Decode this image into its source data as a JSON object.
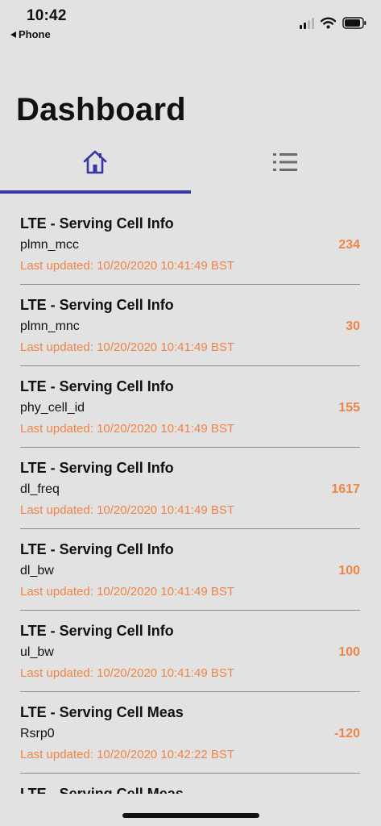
{
  "status_bar": {
    "time": "10:42",
    "back_label": "Phone"
  },
  "page": {
    "title": "Dashboard"
  },
  "tabs": [
    {
      "name": "home",
      "icon": "home-icon",
      "selected": true
    },
    {
      "name": "list",
      "icon": "list-icon",
      "selected": false
    }
  ],
  "colors": {
    "accent": "#3a35a8",
    "value": "#ef8447",
    "background": "#e2e2e2"
  },
  "items": [
    {
      "title": "LTE - Serving Cell Info",
      "key": "plmn_mcc",
      "value": "234",
      "updated": "Last updated: 10/20/2020 10:41:49 BST"
    },
    {
      "title": "LTE - Serving Cell Info",
      "key": "plmn_mnc",
      "value": "30",
      "updated": "Last updated: 10/20/2020 10:41:49 BST"
    },
    {
      "title": "LTE - Serving Cell Info",
      "key": "phy_cell_id",
      "value": "155",
      "updated": "Last updated: 10/20/2020 10:41:49 BST"
    },
    {
      "title": "LTE - Serving Cell Info",
      "key": "dl_freq",
      "value": "1617",
      "updated": "Last updated: 10/20/2020 10:41:49 BST"
    },
    {
      "title": "LTE - Serving Cell Info",
      "key": "dl_bw",
      "value": "100",
      "updated": "Last updated: 10/20/2020 10:41:49 BST"
    },
    {
      "title": "LTE - Serving Cell Info",
      "key": "ul_bw",
      "value": "100",
      "updated": "Last updated: 10/20/2020 10:41:49 BST"
    },
    {
      "title": "LTE - Serving Cell Meas",
      "key": "Rsrp0",
      "value": "-120",
      "updated": "Last updated: 10/20/2020 10:42:22 BST"
    },
    {
      "title": "LTE - Serving Cell Meas",
      "key": "",
      "value": "",
      "updated": ""
    }
  ]
}
